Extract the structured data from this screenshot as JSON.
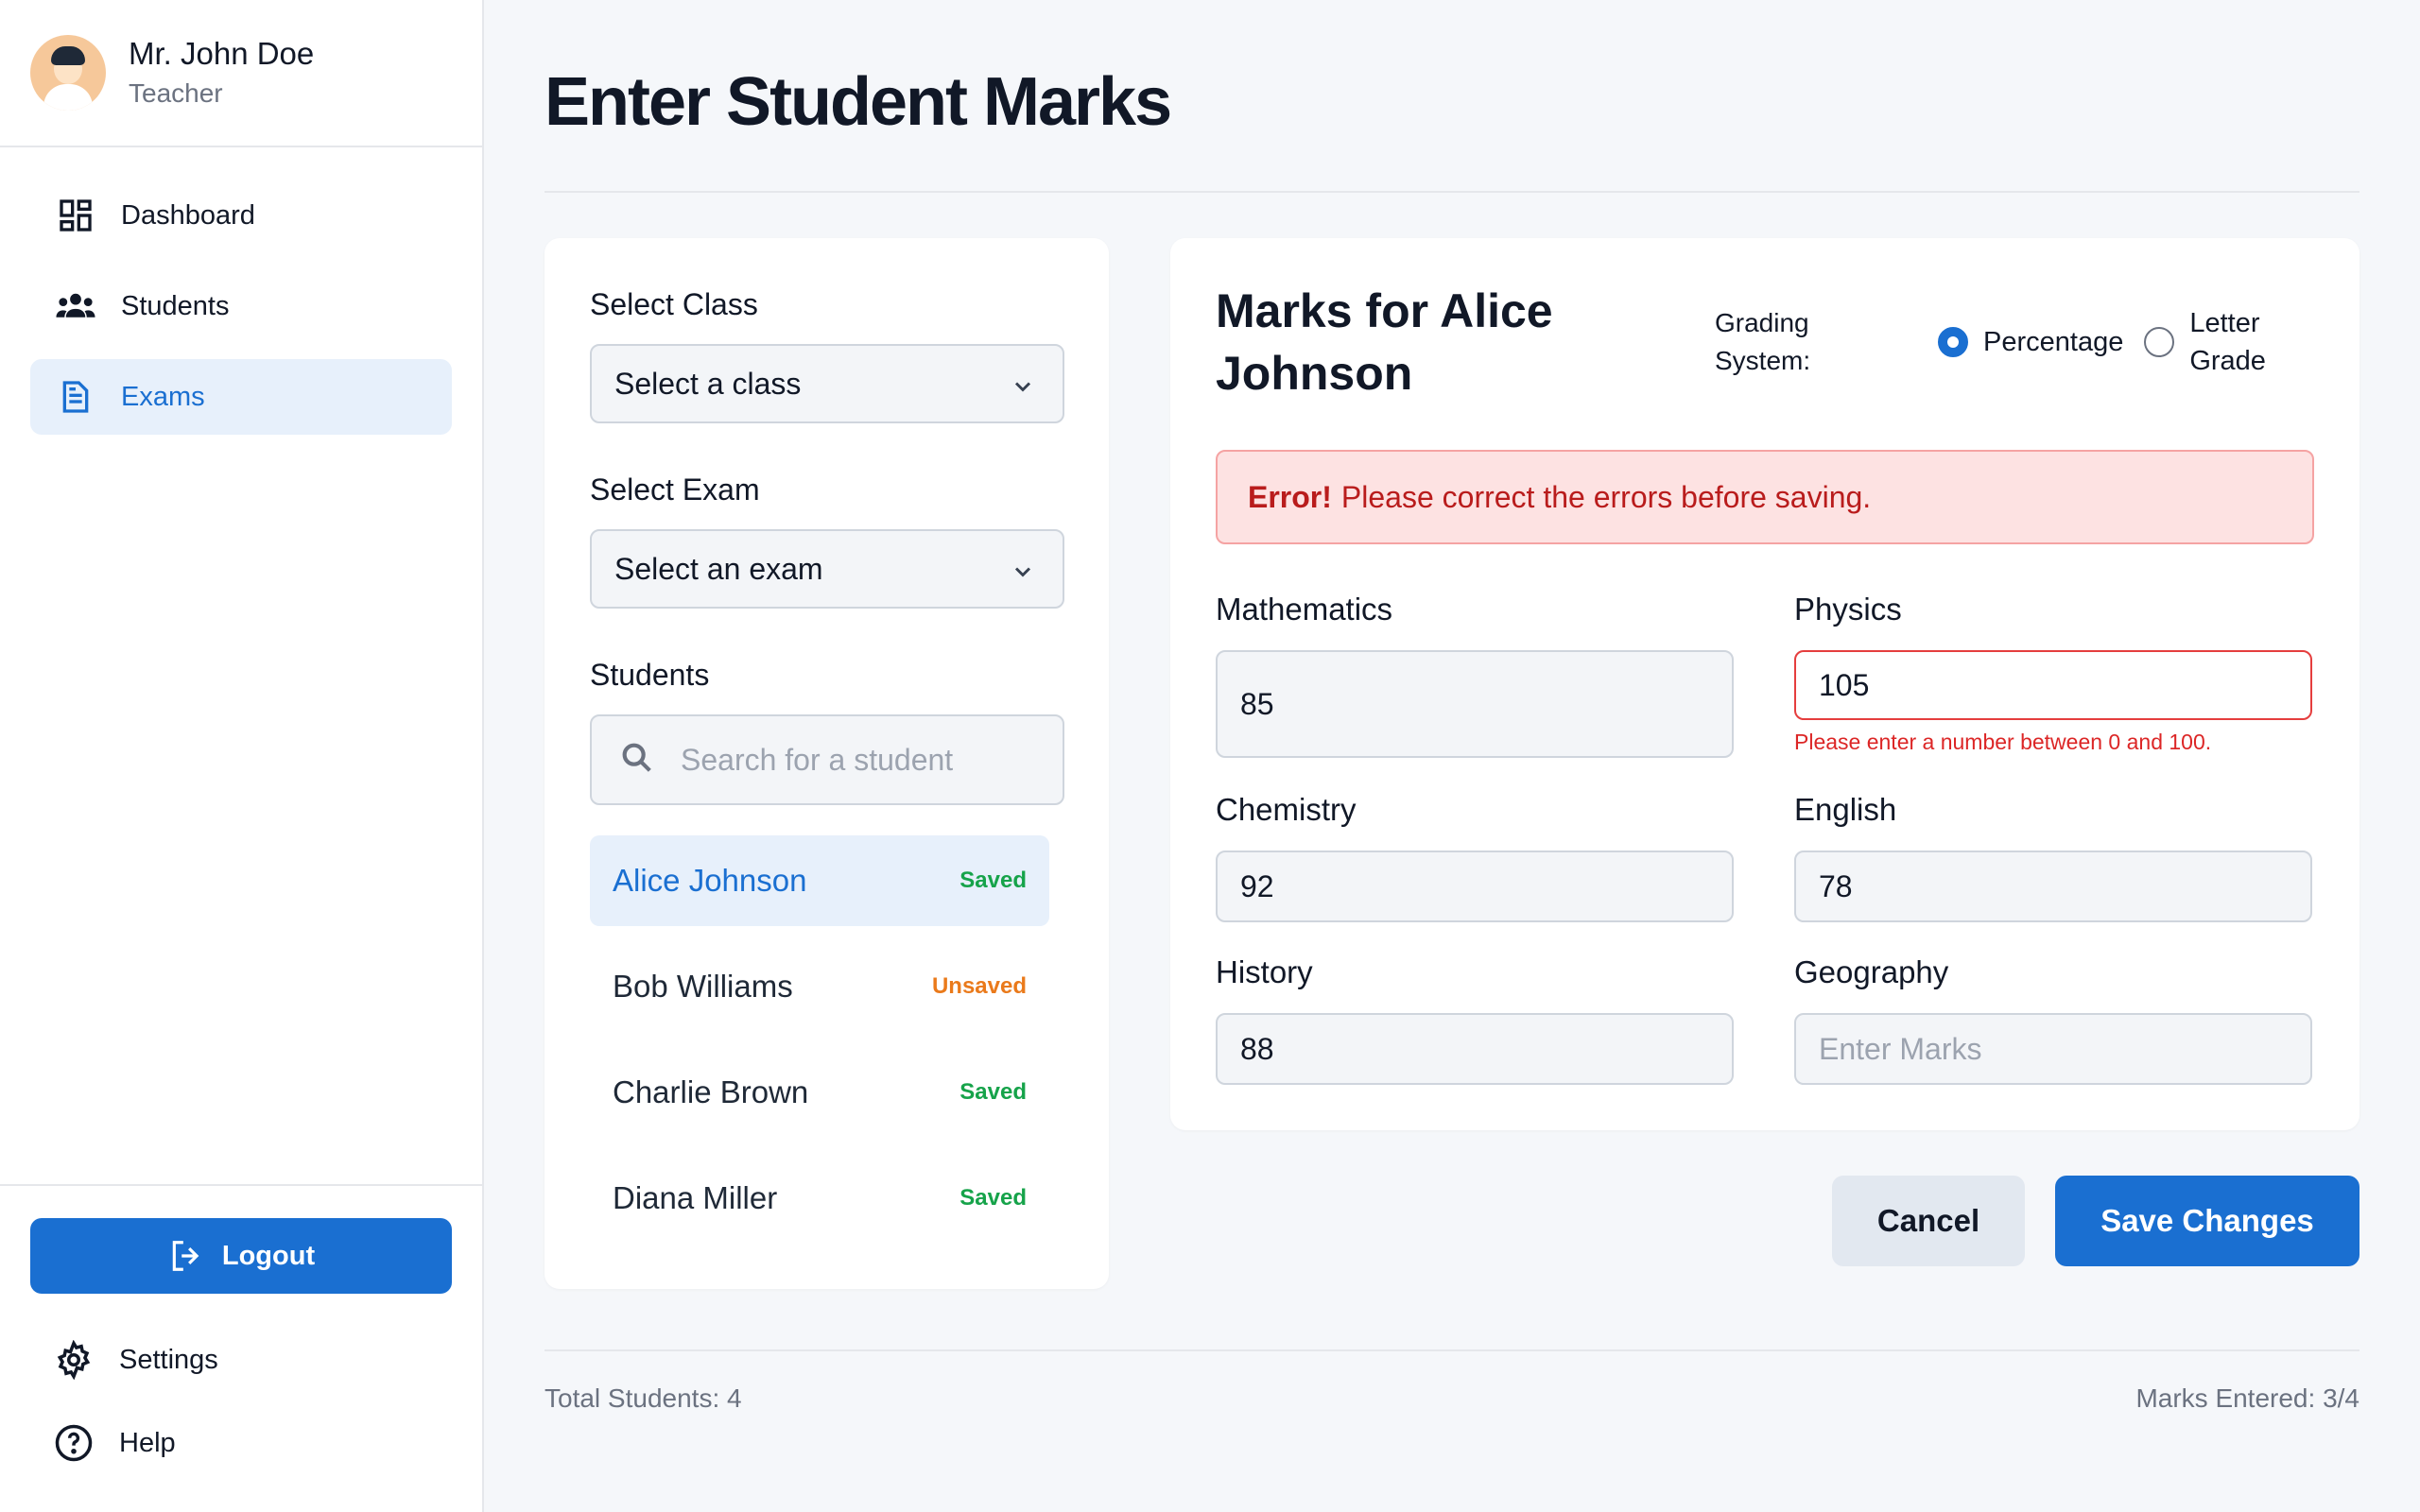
{
  "user": {
    "name": "Mr. John Doe",
    "role": "Teacher"
  },
  "nav": {
    "items": [
      {
        "label": "Dashboard",
        "icon": "dashboard-icon",
        "active": false
      },
      {
        "label": "Students",
        "icon": "students-icon",
        "active": false
      },
      {
        "label": "Exams",
        "icon": "document-icon",
        "active": true
      }
    ],
    "logout_label": "Logout",
    "settings_label": "Settings",
    "help_label": "Help"
  },
  "page": {
    "title": "Enter Student Marks"
  },
  "filters": {
    "class_label": "Select Class",
    "class_value": "Select a class",
    "exam_label": "Select Exam",
    "exam_value": "Select an exam",
    "students_label": "Students",
    "search_placeholder": "Search for a student"
  },
  "students": [
    {
      "name": "Alice Johnson",
      "status": "Saved",
      "status_color": "#16a34a",
      "selected": true
    },
    {
      "name": "Bob Williams",
      "status": "Unsaved",
      "status_color": "#ea7a1b",
      "selected": false
    },
    {
      "name": "Charlie Brown",
      "status": "Saved",
      "status_color": "#16a34a",
      "selected": false
    },
    {
      "name": "Diana Miller",
      "status": "Saved",
      "status_color": "#16a34a",
      "selected": false
    }
  ],
  "marks": {
    "title_line1": "Marks for Alice",
    "title_line2": "Johnson",
    "grading_label_line1": "Grading",
    "grading_label_line2": "System:",
    "grading_options": [
      "Percentage",
      "Letter",
      "Grade"
    ],
    "grading_selected": "Percentage",
    "error_strong": "Error!",
    "error_text": "Please correct the errors before saving.",
    "subjects": [
      {
        "label": "Mathematics",
        "value": "85",
        "placeholder": ""
      },
      {
        "label": "Physics",
        "value": "105",
        "placeholder": "",
        "error": "Please enter a number between 0 and 100."
      },
      {
        "label": "Chemistry",
        "value": "92",
        "placeholder": ""
      },
      {
        "label": "English",
        "value": "78",
        "placeholder": ""
      },
      {
        "label": "History",
        "value": "88",
        "placeholder": ""
      },
      {
        "label": "Geography",
        "value": "",
        "placeholder": "Enter Marks"
      }
    ]
  },
  "actions": {
    "cancel_label": "Cancel",
    "save_label": "Save Changes"
  },
  "footer": {
    "total_students": "Total Students: 4",
    "marks_entered": "Marks Entered: 3/4"
  },
  "colors": {
    "primary": "#1a6fd1",
    "error": "#dc2626",
    "saved": "#16a34a",
    "unsaved": "#ea7a1b"
  }
}
